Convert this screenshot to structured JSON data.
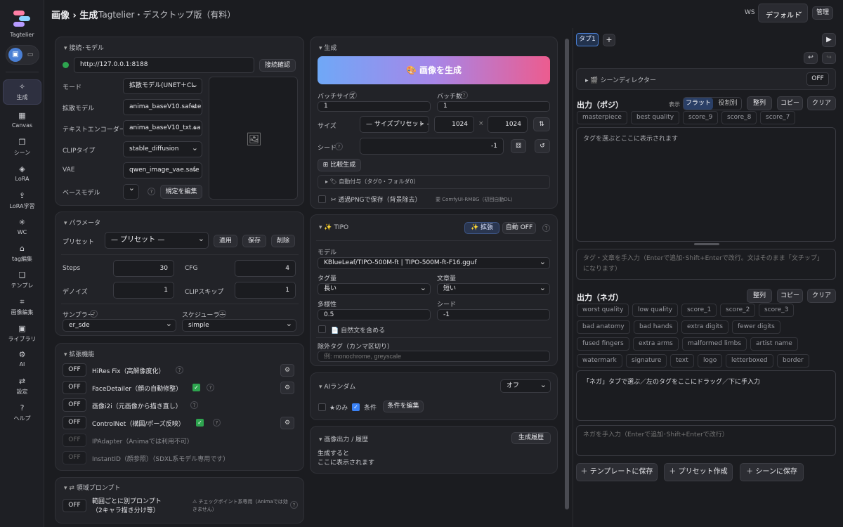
{
  "brand": {
    "name": "Tagtelier"
  },
  "nav": [
    {
      "icon": "✧",
      "label": "生成"
    },
    {
      "icon": "▦",
      "label": "Canvas"
    },
    {
      "icon": "❐",
      "label": "シーン"
    },
    {
      "icon": "◈",
      "label": "LoRA"
    },
    {
      "icon": "⇪",
      "label": "LoRA学習"
    },
    {
      "icon": "✳",
      "label": "WC"
    },
    {
      "icon": "⌂",
      "label": "tag編集"
    },
    {
      "icon": "❏",
      "label": "テンプレ"
    },
    {
      "icon": "⌗",
      "label": "画像編集"
    },
    {
      "icon": "▣",
      "label": "ライブラリ"
    },
    {
      "icon": "⚙",
      "label": "AI"
    },
    {
      "icon": "⇄",
      "label": "設定"
    },
    {
      "icon": "?",
      "label": "ヘルプ"
    }
  ],
  "header": {
    "title": "画像 › 生成",
    "subtitle": "Tagtelier・デスクトップ版（有料）",
    "ws_label": "WS",
    "ws_value": "デフォルト",
    "admin": "管理"
  },
  "connection": {
    "title": "接続･モデル",
    "url": "http://127.0.0.1:8188",
    "check": "接続確認",
    "rows": [
      {
        "label": "モード",
        "value": "拡散モデル(UNET＋CL"
      },
      {
        "label": "拡散モデル",
        "value": "anima_baseV10.safete"
      },
      {
        "label": "テキストエンコーダー",
        "value": "anima_baseV10_txt.sa"
      },
      {
        "label": "CLIPタイプ",
        "value": "stable_diffusion"
      },
      {
        "label": "VAE",
        "value": "qwen_image_vae.safe"
      }
    ],
    "base_label": "ベースモデル",
    "base_value": "",
    "edit_default": "規定を編集"
  },
  "params": {
    "title": "パラメータ",
    "preset_label": "プリセット",
    "preset_value": "— プリセット —",
    "apply": "適用",
    "save": "保存",
    "delete": "削除",
    "steps_label": "Steps",
    "steps": "30",
    "cfg_label": "CFG",
    "cfg": "4",
    "denoise_label": "デノイズ",
    "denoise": "1",
    "clip_label": "CLIPスキップ",
    "clip": "1",
    "sampler_label": "サンプラー",
    "sampler": "er_sde",
    "scheduler_label": "スケジューラー",
    "scheduler": "simple"
  },
  "ext": {
    "title": "拡張機能",
    "items": [
      {
        "state": "OFF",
        "label": "HiRes Fix（高解像度化）"
      },
      {
        "state": "OFF",
        "label": "FaceDetailer（顔の自動修整）"
      },
      {
        "state": "OFF",
        "label": "画像i2i（元画像から描き直し）"
      },
      {
        "state": "OFF",
        "label": "ControlNet（構図/ポーズ反映）"
      },
      {
        "state": "OFF",
        "label": "IPAdapter（Animaでは利用不可）"
      },
      {
        "state": "OFF",
        "label": "InstantID（顔参照）（SDXL系モデル専用です）"
      }
    ]
  },
  "region": {
    "title": "領域プロンプト",
    "state": "OFF",
    "label": "範囲ごとに別プロンプト（2キャラ描き分け等）",
    "note": "⚠ チェックポイント系専用（Animaでは効きません）"
  },
  "gen": {
    "title": "生成",
    "button": "🎨 画像を生成",
    "batch_size_label": "バッチサイズ",
    "batch_size": "1",
    "batch_count_label": "バッチ数",
    "batch_count": "1",
    "size_label": "サイズ",
    "size_preset": "— サイズプリセット —",
    "width": "1024",
    "height": "1024",
    "swap": "⇅",
    "seed_label": "シード",
    "seed": "-1",
    "compare": "⊞ 比較生成",
    "auto_tag": "▸ 🏷 自動付与（タグ0・フォルダ0）",
    "transparent": "✂ 透過PNGで保存（背景除去）",
    "transparent_note": "要 ComfyUI-RMBG（初回自動DL）"
  },
  "tipo": {
    "title": "✨ TIPO",
    "expand": "✨ 拡張",
    "auto": "自動 OFF",
    "model_label": "モデル",
    "model": "KBlueLeaf/TIPO-500M-ft | TIPO-500M-ft-F16.gguf",
    "tag_amount_label": "タグ量",
    "tag_amount": "長い",
    "text_amount_label": "文章量",
    "text_amount": "短い",
    "diversity_label": "多様性",
    "diversity": "0.5",
    "seed_label": "シード",
    "seed": "-1",
    "natural": "📄 自然文を含める",
    "exclude_label": "除外タグ（カンマ区切り）",
    "exclude_placeholder": "例: monochrome, greyscale"
  },
  "airandom": {
    "title": "AIランダム",
    "value": "オフ",
    "star": "★のみ",
    "cond": "条件",
    "edit": "条件を編集"
  },
  "history": {
    "title": "画像出力 / 履歴",
    "button": "生成履歴",
    "empty": "生成すると\nここに表示されます"
  },
  "right": {
    "tab": "タブ1",
    "add": "+",
    "scene": "▸ 🎬 シーンディレクター",
    "scene_state": "OFF",
    "pos_title": "出力（ポジ）",
    "view_label": "表示",
    "flat": "フラット",
    "by_role": "役割別",
    "sort": "整列",
    "copy": "コピー",
    "clear": "クリア",
    "pos_tags": [
      "masterpiece",
      "best quality",
      "score_9",
      "score_8",
      "score_7"
    ],
    "pos_area": "タグを選ぶとここに表示されます",
    "pos_input_placeholder": "タグ・文章を手入力（Enterで追加･Shift+Enterで改行。文はそのまま「文チップ」になります）",
    "neg_title": "出力（ネガ）",
    "neg_tags": [
      "worst quality",
      "low quality",
      "score_1",
      "score_2",
      "score_3",
      "bad anatomy",
      "bad hands",
      "extra digits",
      "fewer digits",
      "fused fingers",
      "extra arms",
      "malformed limbs",
      "artist name",
      "watermark",
      "signature",
      "text",
      "logo",
      "letterboxed",
      "border"
    ],
    "neg_area": "「ネガ」タブで選ぶ／左のタグをここにドラッグ／下に手入力",
    "neg_input_placeholder": "ネガを手入力（Enterで追加･Shift+Enterで改行）",
    "save_template": "＋ テンプレートに保存",
    "create_preset": "＋ プリセット作成",
    "save_scene": "＋ シーンに保存"
  },
  "colors": {
    "accent": "#4a7fd4",
    "gen_gradient_start": "#6fa8f7",
    "gen_gradient_end": "#ec5c8f",
    "status_ok": "#2ea44f"
  }
}
